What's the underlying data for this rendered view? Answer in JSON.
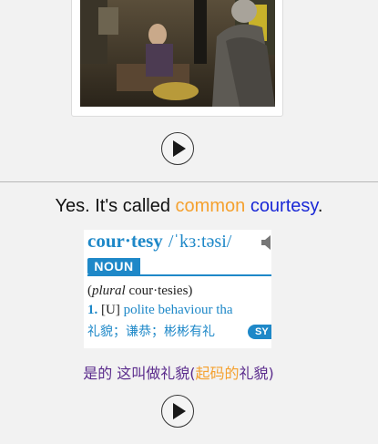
{
  "top_card": {
    "video_label": "",
    "play_button_label": "play"
  },
  "sentence": {
    "before": "Yes. It's called ",
    "word1": "common",
    "space": " ",
    "word2": "courtesy",
    "after": ".",
    "colors": {
      "word1": "#f5a12f",
      "word2": "#1a28d6"
    }
  },
  "dictionary": {
    "headword": "cour·tesy",
    "pronunciation": "/ˈkɜːtəsi/",
    "part_of_speech": "NOUN",
    "plural_label": "plural",
    "plural_form": "cour·tesies",
    "sense_number": "1.",
    "grammar_code": "[U]",
    "definition": "polite behaviour tha",
    "chinese_definition": "礼貌；谦恭；彬彬有礼",
    "synonym_tag": "SY",
    "accent_color": "#1e88c8"
  },
  "translation": {
    "part1": "是的 这叫做礼貌(",
    "highlight": "起码的",
    "part2": "礼貌)"
  },
  "bottom_play_label": "play"
}
